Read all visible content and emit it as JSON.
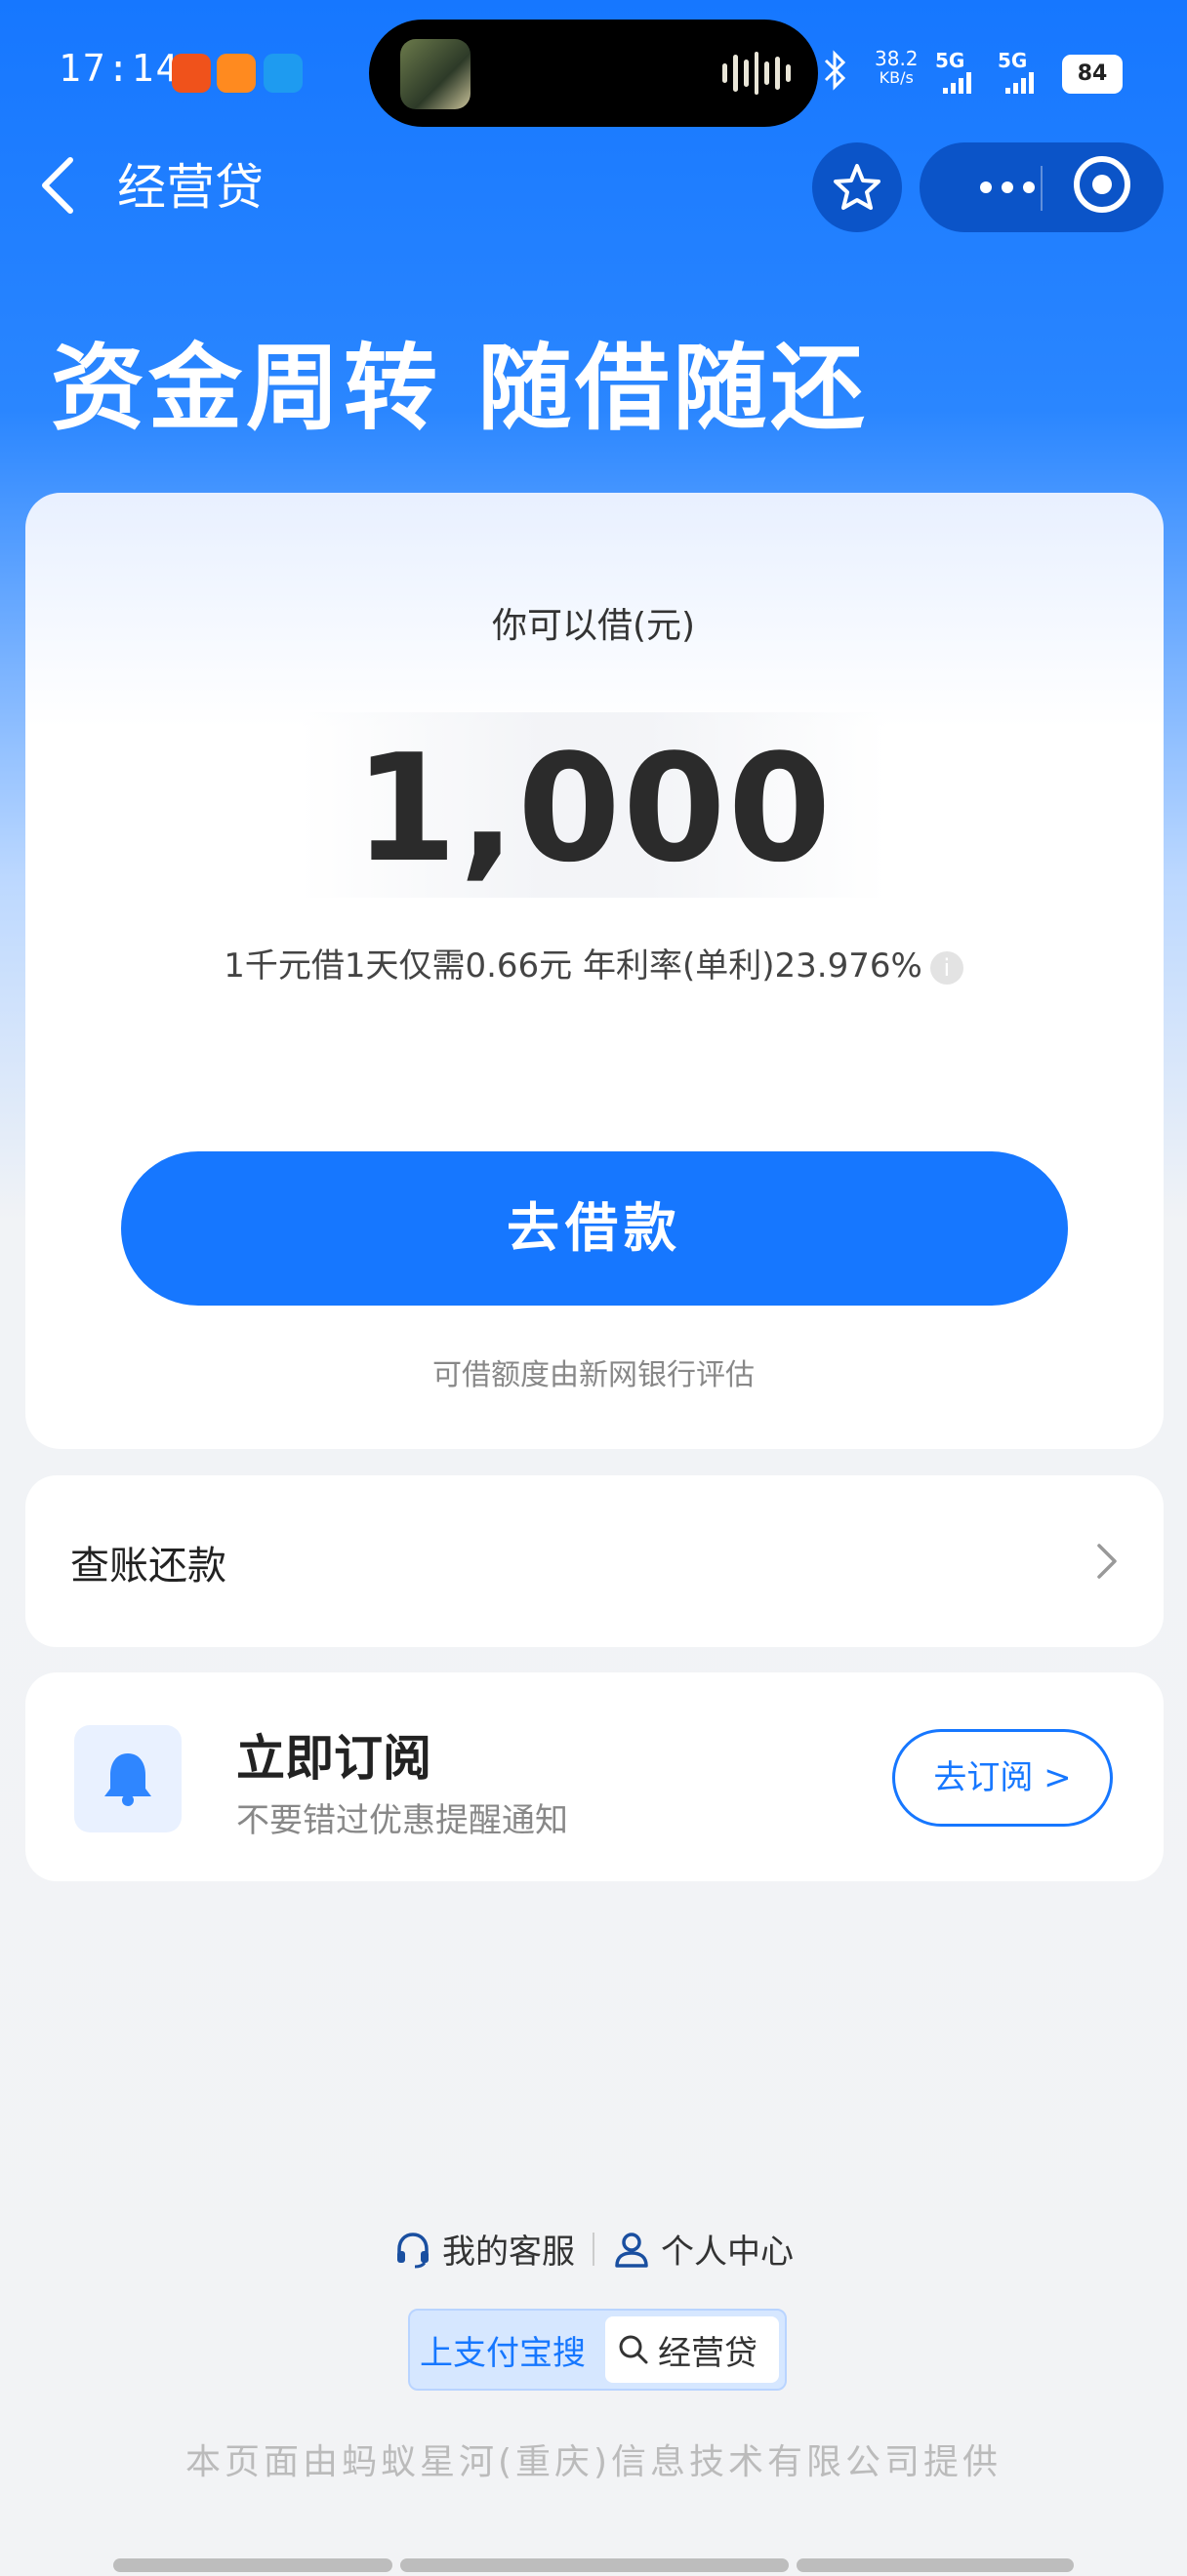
{
  "status_bar": {
    "time": "17:14",
    "network_speed": "38.2",
    "network_unit": "KB/s",
    "signal1": "5G",
    "signal2": "5G",
    "battery": "84"
  },
  "nav": {
    "title": "经营贷"
  },
  "hero": {
    "headline": "资金周转  随借随还"
  },
  "loan": {
    "label": "你可以借(元)",
    "amount": "1,000",
    "rate_text": "1千元借1天仅需0.66元  年利率(单利)23.976%",
    "info_glyph": "i",
    "button_label": "去借款",
    "note": "可借额度由新网银行评估"
  },
  "repay": {
    "label": "查账还款"
  },
  "subscribe": {
    "title": "立即订阅",
    "desc": "不要错过优惠提醒通知",
    "button_label": "去订阅 >"
  },
  "footer": {
    "service_label": "我的客服",
    "personal_label": "个人中心",
    "search_prefix": "上支付宝搜",
    "search_keyword": "经营贷",
    "provider": "本页面由蚂蚁星河(重庆)信息技术有限公司提供"
  },
  "colors": {
    "primary": "#1677ff",
    "capsule": "#0b54c8"
  }
}
